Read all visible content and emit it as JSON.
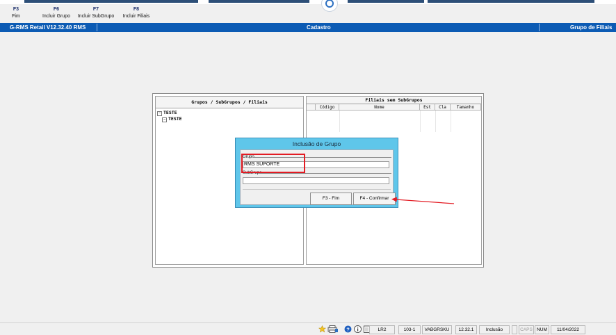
{
  "toolbar": {
    "keys": [
      {
        "key": "F3",
        "label": "Fim"
      },
      {
        "key": "F6",
        "label": "Incluir Grupo"
      },
      {
        "key": "F7",
        "label": "Incluir SubGrupo"
      },
      {
        "key": "F8",
        "label": "Incluir Filiais"
      }
    ]
  },
  "titlebar": {
    "app": "G-RMS Retail V12.32.40 RMS",
    "screen": "Cadastro",
    "section": "Grupo de Filiais",
    "color": "#0c5bb4"
  },
  "left_pane": {
    "header": "Grupos / SubGrupos / Filiais",
    "tree": [
      {
        "label": "TESTE",
        "level": 0,
        "expander": "−"
      },
      {
        "label": "TESTE",
        "level": 1,
        "expander": "−"
      }
    ]
  },
  "right_pane": {
    "header": "Filiais sem SubGrupos",
    "columns": [
      "Código",
      "Nome",
      "Est",
      "Cla",
      "Tamanho"
    ]
  },
  "modal": {
    "title": "Inclusão de Grupo",
    "grupo_label": "Grupo",
    "grupo_value": "RMS SUPORTE",
    "subgrupo_label": "SubGrupo",
    "subgrupo_value": "",
    "btn_fim": "F3 - Fim",
    "btn_confirmar": "F4 - Confirmar",
    "accent": "#5fc6ea"
  },
  "annotation": {
    "color": "#e31b23"
  },
  "statusbar": {
    "icons": [
      "star-icon",
      "printer-icon",
      "help-icon",
      "info-icon",
      "notepad-icon"
    ],
    "cells": [
      "LR2",
      "103-1",
      "VABGRSKU",
      "12.32.1",
      "Inclusão",
      "",
      "CAPS",
      "NUM",
      "11/04/2022"
    ]
  }
}
